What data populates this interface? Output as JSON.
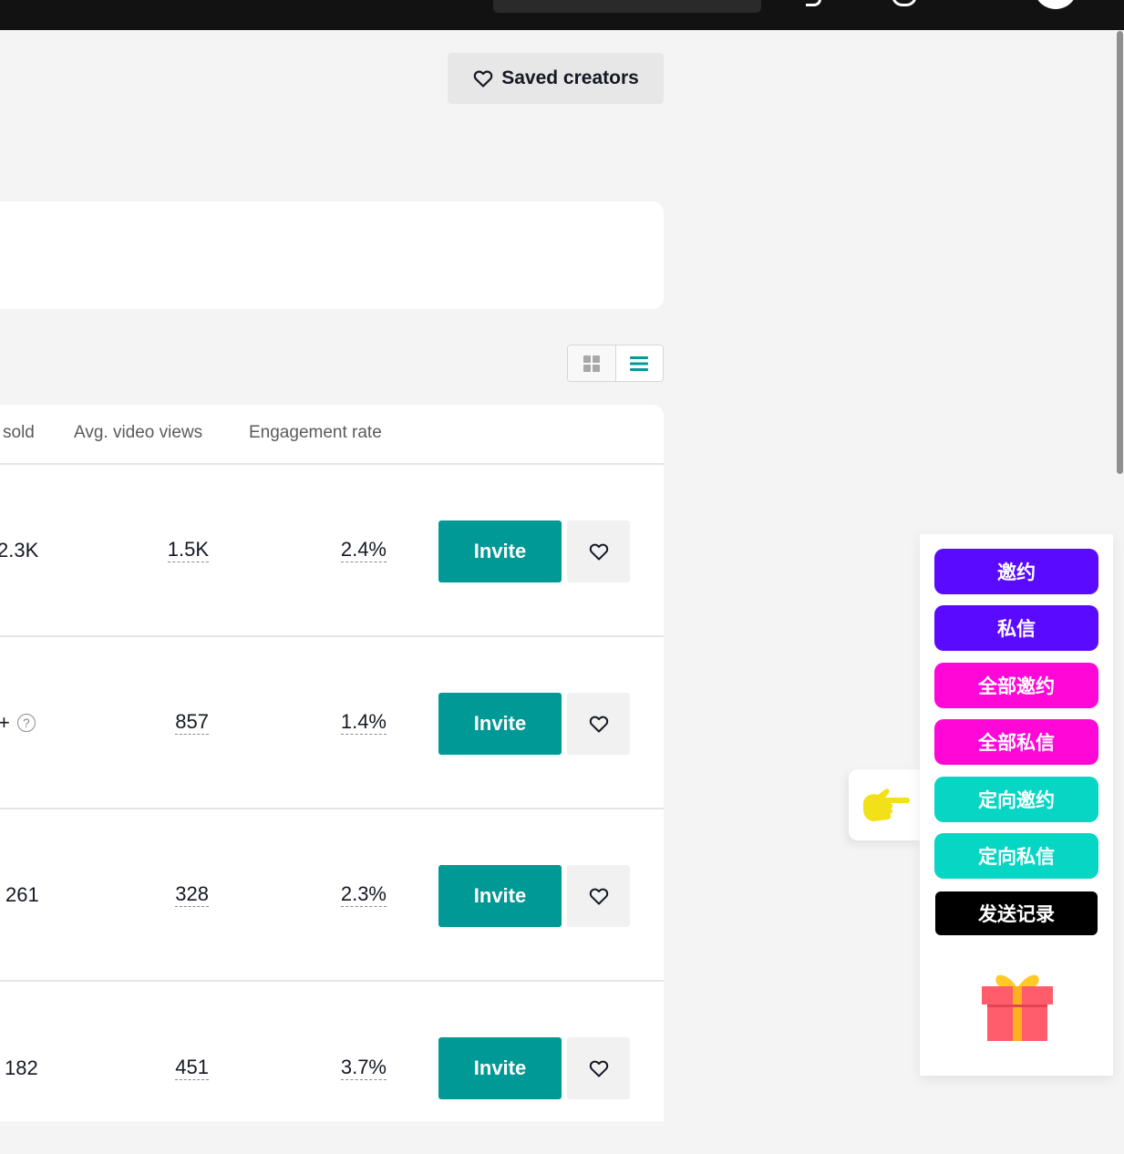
{
  "header": {
    "saved_creators_label": "Saved creators"
  },
  "table": {
    "columns": {
      "sold": "sold",
      "avg_video_views": "Avg. video views",
      "engagement_rate": "Engagement rate"
    },
    "invite_label": "Invite",
    "rows": [
      {
        "sold": "2.3K",
        "views": "1.5K",
        "engagement": "2.4%"
      },
      {
        "sold": "+",
        "views": "857",
        "engagement": "1.4%"
      },
      {
        "sold": "261",
        "views": "328",
        "engagement": "2.3%"
      },
      {
        "sold": "182",
        "views": "451",
        "engagement": "3.7%"
      }
    ]
  },
  "plugin": {
    "buttons": [
      {
        "label": "邀约",
        "color": "#5a0bff"
      },
      {
        "label": "私信",
        "color": "#5a0bff"
      },
      {
        "label": "全部邀约",
        "color": "#ff08d7"
      },
      {
        "label": "全部私信",
        "color": "#ff08d7"
      },
      {
        "label": "定向邀约",
        "color": "#08d6c4"
      },
      {
        "label": "定向私信",
        "color": "#08d6c4"
      },
      {
        "label": "发送记录",
        "color": "#000000"
      }
    ]
  },
  "colors": {
    "invite": "#009995",
    "topbar": "#121212"
  }
}
